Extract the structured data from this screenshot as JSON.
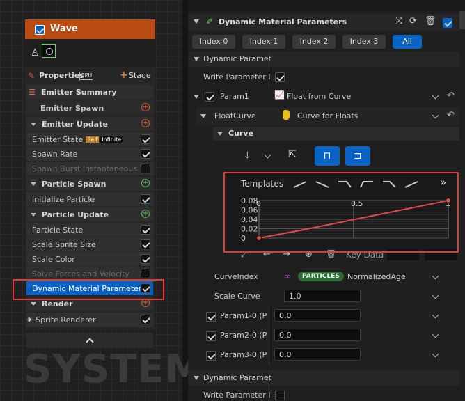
{
  "system": {
    "node_title": "Wave",
    "properties_label": "Properties",
    "properties_badge": "CPU",
    "stage_label": "Stage",
    "watermark": "SYSTEM",
    "items": [
      {
        "label": "Emitter Summary",
        "kind": "section"
      },
      {
        "label": "Emitter Spawn",
        "kind": "sub"
      },
      {
        "label": "Emitter Update",
        "kind": "section"
      },
      {
        "label": "Emitter State",
        "kind": "item",
        "badge_self": "Self",
        "badge_inf": "Infinite",
        "checked": true
      },
      {
        "label": "Spawn Rate",
        "kind": "item",
        "checked": true
      },
      {
        "label": "Spawn Burst Instantaneous",
        "kind": "item",
        "checked": false,
        "dim": true
      },
      {
        "label": "Particle Spawn",
        "kind": "section"
      },
      {
        "label": "Initialize Particle",
        "kind": "item",
        "checked": true
      },
      {
        "label": "Particle Update",
        "kind": "section"
      },
      {
        "label": "Particle State",
        "kind": "item",
        "checked": true
      },
      {
        "label": "Scale Sprite Size",
        "kind": "item",
        "checked": true
      },
      {
        "label": "Scale Color",
        "kind": "item",
        "checked": true
      },
      {
        "label": "Solve Forces and Velocity",
        "kind": "item",
        "checked": false,
        "dim": true
      },
      {
        "label": "Dynamic Material Parameters",
        "kind": "item",
        "checked": true,
        "selected": true
      },
      {
        "label": "Render",
        "kind": "section"
      },
      {
        "label": "Sprite Renderer",
        "kind": "item",
        "checked": true
      }
    ]
  },
  "details": {
    "header_title": "Dynamic Material Parameters",
    "index_tabs": [
      "Index 0",
      "Index 1",
      "Index 2",
      "Index 3",
      "All"
    ],
    "selected_tab": "All",
    "section1_label": "Dynamic Paramet",
    "write_param_label": "Write Parameter I",
    "param1_label": "Param1",
    "param1_value": "Float from Curve",
    "floatcurve_label": "FloatCurve",
    "floatcurve_value": "Curve for Floats",
    "curve_label": "Curve",
    "templates_label": "Templates",
    "key_data_label": "Key Data",
    "curveindex_label": "CurveIndex",
    "particles_badge": "PARTICLES",
    "curveindex_value": "NormalizedAge",
    "scale_curve_label": "Scale Curve",
    "scale_curve_value": "1.0",
    "params": [
      {
        "label": "Param1-0 (P",
        "value": "0.0"
      },
      {
        "label": "Param2-0 (P",
        "value": "0.0"
      },
      {
        "label": "Param3-0 (P",
        "value": "0.0"
      }
    ],
    "section2_label": "Dynamic Paramet",
    "write_param2_label": "Write Parameter I"
  },
  "chart_data": {
    "type": "line",
    "x": [
      0,
      0.2,
      1
    ],
    "y": [
      0,
      0.015,
      0.08
    ],
    "x_ticks": [
      "0",
      "0.5",
      "1"
    ],
    "y_ticks": [
      "0.08",
      "0.06",
      "0.04",
      "0.02",
      "0"
    ],
    "xlim": [
      0,
      1
    ],
    "ylim": [
      0,
      0.08
    ],
    "line_color": "#e04a4a",
    "grid": true
  },
  "colors": {
    "accent": "#0a62c4",
    "node_header": "#b84b12",
    "highlight": "#e03a3a"
  }
}
